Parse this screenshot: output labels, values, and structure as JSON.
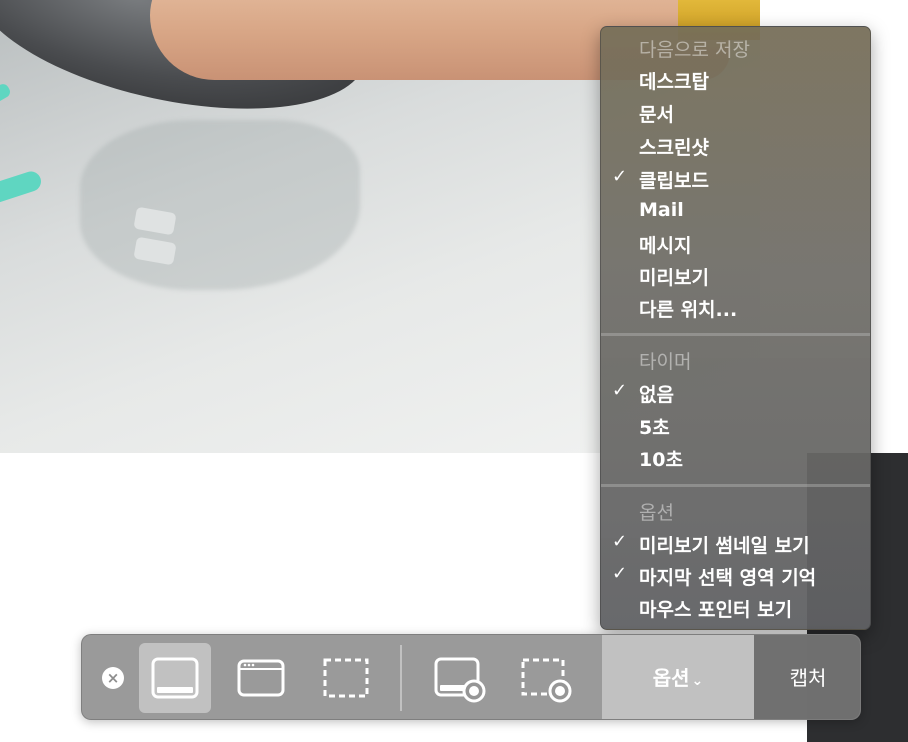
{
  "menu": {
    "save_to": {
      "header": "다음으로 저장",
      "items": [
        {
          "label": "데스크탑",
          "checked": false
        },
        {
          "label": "문서",
          "checked": false
        },
        {
          "label": "스크린샷",
          "checked": false
        },
        {
          "label": "클립보드",
          "checked": true
        },
        {
          "label": "Mail",
          "checked": false
        },
        {
          "label": "메시지",
          "checked": false
        },
        {
          "label": "미리보기",
          "checked": false
        },
        {
          "label": "다른 위치...",
          "checked": false
        }
      ]
    },
    "timer": {
      "header": "타이머",
      "items": [
        {
          "label": "없음",
          "checked": true
        },
        {
          "label": "5초",
          "checked": false
        },
        {
          "label": "10초",
          "checked": false
        }
      ]
    },
    "options": {
      "header": "옵션",
      "items": [
        {
          "label": "미리보기 썸네일 보기",
          "checked": true
        },
        {
          "label": "마지막 선택 영역 기억",
          "checked": true
        },
        {
          "label": "마우스 포인터 보기",
          "checked": false
        }
      ]
    },
    "check_glyph": "✓"
  },
  "toolbar": {
    "close_glyph": "×",
    "options_label": "옵션",
    "options_chevron": "⌄",
    "capture_label": "캡처",
    "selected_mode": "capture-entire-screen"
  },
  "colors": {
    "teal_accent": "#5fd6c1",
    "sleeve_yellow": "#e2b83a"
  }
}
